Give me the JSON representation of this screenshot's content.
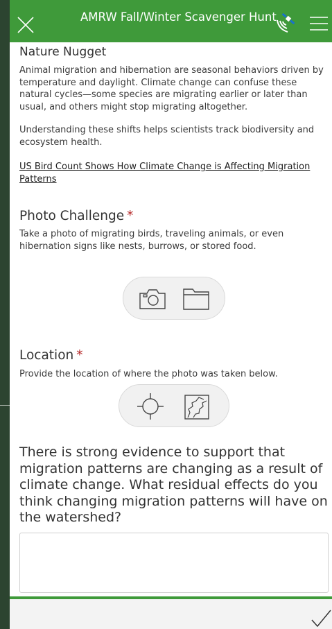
{
  "header": {
    "title": "AMRW Fall/Winter Scavenger Hunt",
    "close_icon": "close-icon",
    "gps_icon": "satellite-gps-icon",
    "menu_icon": "hamburger-menu-icon",
    "color": "#3f9a3a"
  },
  "nugget": {
    "heading": "Nature Nugget",
    "paragraph1": "Animal migration and hibernation are seasonal behaviors driven by temperature and daylight. Climate change can confuse these natural cycles—some species are migrating earlier or later than usual, and others might stop migrating altogether.",
    "paragraph2": "Understanding these shifts helps scientists track biodiversity and ecosystem health.",
    "link_text": "US Bird Count Shows How Climate Change is Affecting Migration Patterns"
  },
  "photo": {
    "title": "Photo Challenge",
    "required_mark": "*",
    "description": "Take a photo of migrating birds, traveling animals, or even hibernation signs like nests, burrows, or stored food.",
    "camera_icon": "camera-icon",
    "folder_icon": "folder-icon"
  },
  "location": {
    "title": "Location",
    "required_mark": "*",
    "description": "Provide the location of where the photo was taken below.",
    "crosshair_icon": "crosshair-icon",
    "map_icon": "map-icon"
  },
  "question": {
    "text": "There is strong evidence to support that migration patterns are changing as a result of climate change. What residual effects do you think changing migration patterns will have on the watershed?",
    "answer_value": ""
  },
  "footer": {
    "submit_icon": "checkmark-icon"
  },
  "colors": {
    "accent": "#3f9a3a",
    "required": "#b32424",
    "side_strip": "#233a25"
  }
}
